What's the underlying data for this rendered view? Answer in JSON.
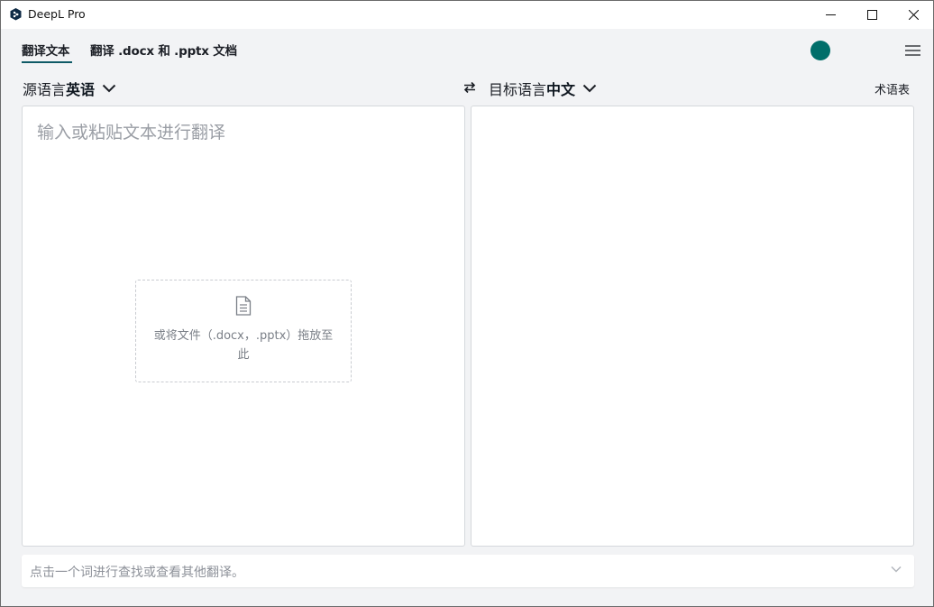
{
  "window": {
    "title": "DeepL Pro"
  },
  "tabs": [
    {
      "label": "翻译文本",
      "active": true
    },
    {
      "label": "翻译 .docx 和 .pptx 文档",
      "active": false
    }
  ],
  "language": {
    "source_prefix": "源语言",
    "source_name": "英语",
    "target_prefix": "目标语言",
    "target_name": "中文",
    "glossary_label": "术语表"
  },
  "source_panel": {
    "placeholder": "输入或粘贴文本进行翻译",
    "drop_text": "或将文件（.docx，.pptx）拖放至此"
  },
  "bottom_bar": {
    "hint": "点击一个词进行查找或查看其他翻译。"
  },
  "colors": {
    "accent": "#0f5a66",
    "avatar": "#006e6a",
    "background": "#f2f3f5"
  },
  "icons": {
    "app_logo": "deepl-logo-icon",
    "swap": "swap-arrows-icon",
    "document": "document-icon",
    "menu": "hamburger-menu-icon"
  }
}
